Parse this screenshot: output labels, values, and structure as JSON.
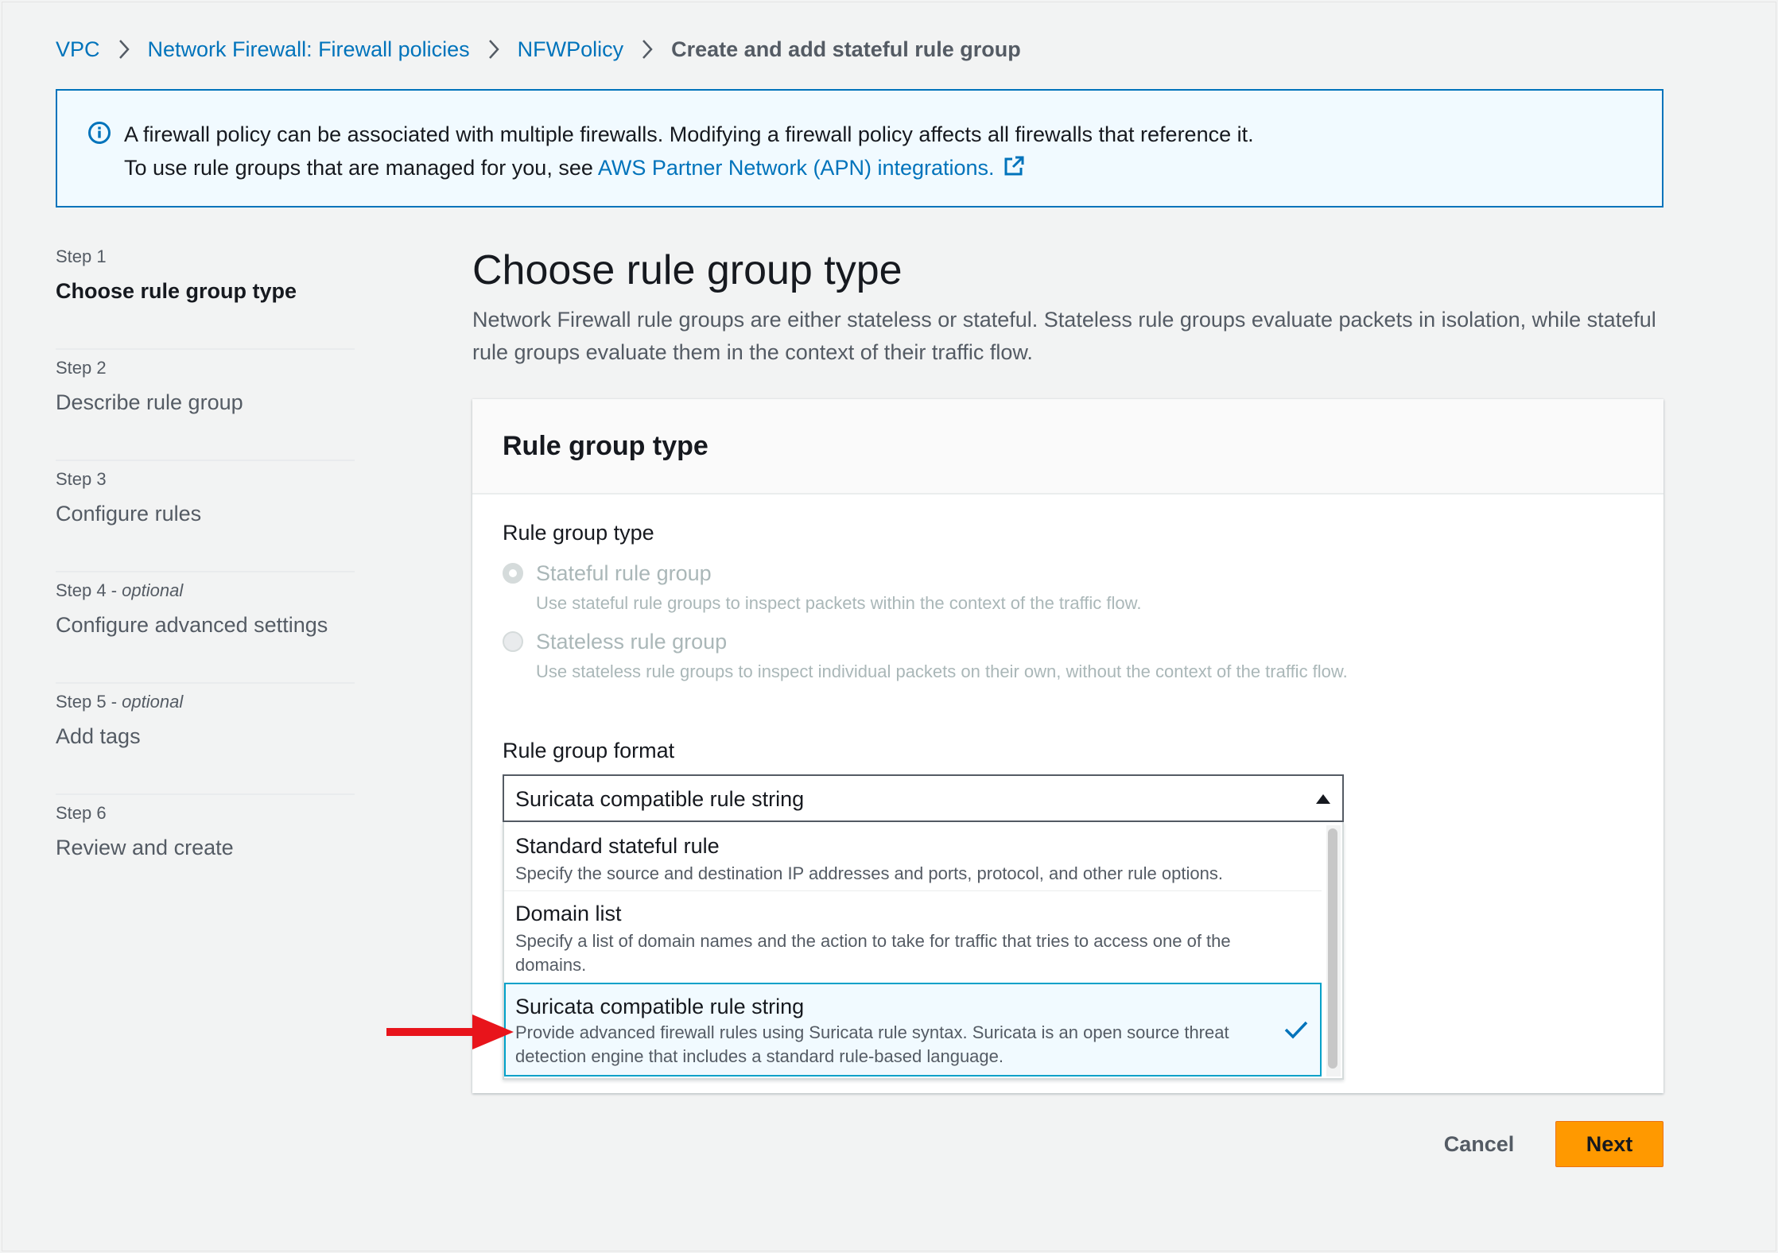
{
  "breadcrumb": {
    "items": [
      "VPC",
      "Network Firewall: Firewall policies",
      "NFWPolicy"
    ],
    "current": "Create and add stateful rule group"
  },
  "info": {
    "line1": "A firewall policy can be associated with multiple firewalls. Modifying a firewall policy affects all firewalls that reference it.",
    "line2_prefix": "To use rule groups that are managed for you, see ",
    "line2_link": "AWS Partner Network (APN) integrations."
  },
  "steps": [
    {
      "number": "Step 1",
      "optional": "",
      "title": "Choose rule group type"
    },
    {
      "number": "Step 2",
      "optional": "",
      "title": "Describe rule group"
    },
    {
      "number": "Step 3",
      "optional": "",
      "title": "Configure rules"
    },
    {
      "number": "Step 4 - ",
      "optional": "optional",
      "title": "Configure advanced settings"
    },
    {
      "number": "Step 5 - ",
      "optional": "optional",
      "title": "Add tags"
    },
    {
      "number": "Step 6",
      "optional": "",
      "title": "Review and create"
    }
  ],
  "main": {
    "title": "Choose rule group type",
    "description": "Network Firewall rule groups are either stateless or stateful. Stateless rule groups evaluate packets in isolation, while stateful rule groups evaluate them in the context of their traffic flow."
  },
  "panel": {
    "header": "Rule group type",
    "type_label": "Rule group type",
    "radios": [
      {
        "title": "Stateful rule group",
        "desc": "Use stateful rule groups to inspect packets within the context of the traffic flow."
      },
      {
        "title": "Stateless rule group",
        "desc": "Use stateless rule groups to inspect individual packets on their own, without the context of the traffic flow."
      }
    ],
    "format_label": "Rule group format",
    "format_value": "Suricata compatible rule string",
    "options": [
      {
        "title": "Standard stateful rule",
        "desc": "Specify the source and destination IP addresses and ports, protocol, and other rule options."
      },
      {
        "title": "Domain list",
        "desc": "Specify a list of domain names and the action to take for traffic that tries to access one of the domains."
      },
      {
        "title": "Suricata compatible rule string",
        "desc": "Provide advanced firewall rules using Suricata rule syntax. Suricata is an open source threat detection engine that includes a standard rule-based language."
      }
    ]
  },
  "footer": {
    "cancel": "Cancel",
    "next": "Next"
  },
  "colors": {
    "link": "#0073bb",
    "accent_button": "#ff9900",
    "annotation_arrow": "#e8141b"
  }
}
